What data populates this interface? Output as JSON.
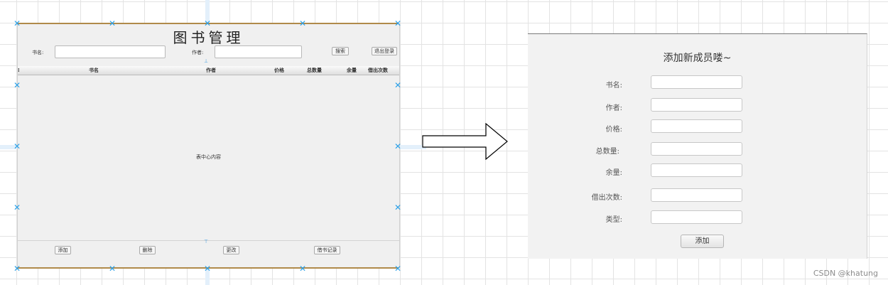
{
  "main_window": {
    "title": "图书管理",
    "search_name_label": "书名:",
    "search_author_label": "作者:",
    "search_button": "搜索",
    "logout_button": "退出登录",
    "table_columns": [
      "书名",
      "作者",
      "价格",
      "总数量",
      "余量",
      "借出次数"
    ],
    "table_placeholder": "表中心内容",
    "buttons": [
      "添加",
      "删除",
      "更改",
      "借书记录"
    ]
  },
  "dialog": {
    "title": "添加新成员喽~",
    "fields": [
      {
        "label": "书名:",
        "value": ""
      },
      {
        "label": "作者:",
        "value": ""
      },
      {
        "label": "价格:",
        "value": ""
      },
      {
        "label": "总数量:",
        "value": ""
      },
      {
        "label": "余量:",
        "value": ""
      },
      {
        "label": "借出次数:",
        "value": ""
      },
      {
        "label": "类型:",
        "value": ""
      }
    ],
    "submit_button": "添加"
  },
  "watermark": "CSDN @khatung",
  "colors": {
    "selection_handle": "#2aa0e8",
    "frame_border": "#b08a4a"
  }
}
